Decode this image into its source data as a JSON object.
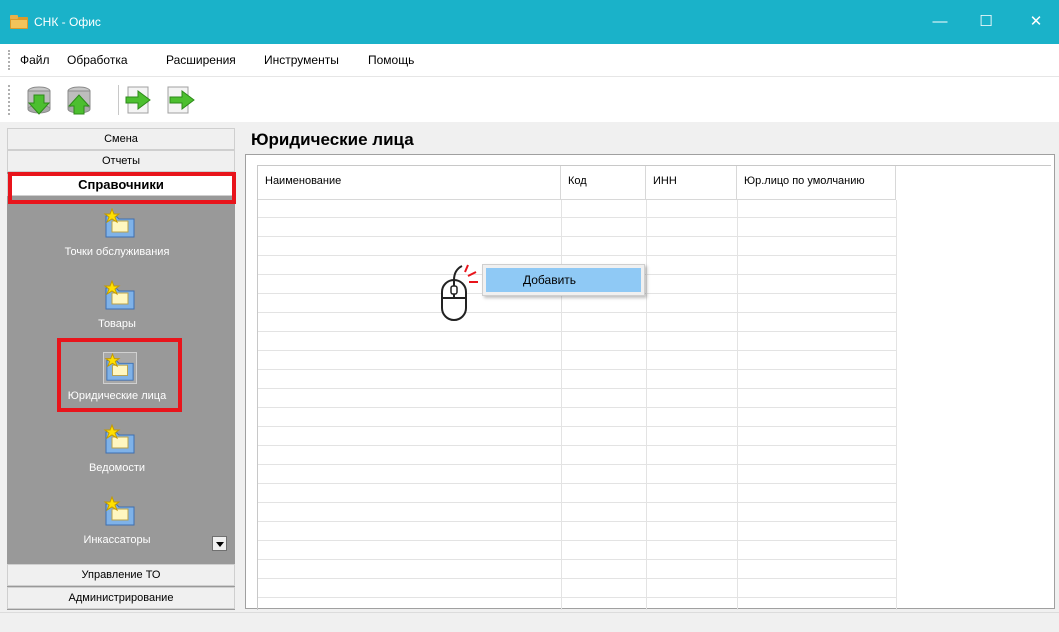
{
  "window": {
    "title": "СНК - Офис",
    "app_icon": "folder-icon",
    "title_bar_color": "#1ab2c9",
    "controls": {
      "minimize": "—",
      "maximize": "☐",
      "close": "✕"
    }
  },
  "menu": {
    "items": [
      "Файл",
      "Обработка",
      "Расширения",
      "Инструменты",
      "Помощь"
    ]
  },
  "toolbar": {
    "buttons": [
      "database-download-icon",
      "database-upload-icon",
      "export-arrow-icon",
      "import-arrow-icon"
    ]
  },
  "sidebar": {
    "sections": [
      "Смена",
      "Отчеты",
      "Справочники",
      "Управление ТО",
      "Администрирование"
    ],
    "active_section": "Справочники",
    "items": [
      {
        "label": "Точки обслуживания",
        "icon": "folder-star-icon"
      },
      {
        "label": "Товары",
        "icon": "folder-star-icon"
      },
      {
        "label": "Юридические лица",
        "icon": "folder-star-icon"
      },
      {
        "label": "Ведомости",
        "icon": "folder-star-icon"
      },
      {
        "label": "Инкассаторы",
        "icon": "folder-star-icon"
      }
    ],
    "selected_item": "Юридические лица",
    "background": "#999999"
  },
  "content": {
    "title": "Юридические лица",
    "table": {
      "columns": [
        "Наименование",
        "Код",
        "ИНН",
        "Юр.лицо по умолчанию"
      ],
      "rows": []
    }
  },
  "context_menu": {
    "items": [
      "Добавить"
    ],
    "highlight_color": "#8fc9f5"
  },
  "annotations": {
    "highlight_color": "#e8141b",
    "mouse_hint": "right-click-mouse-icon"
  }
}
